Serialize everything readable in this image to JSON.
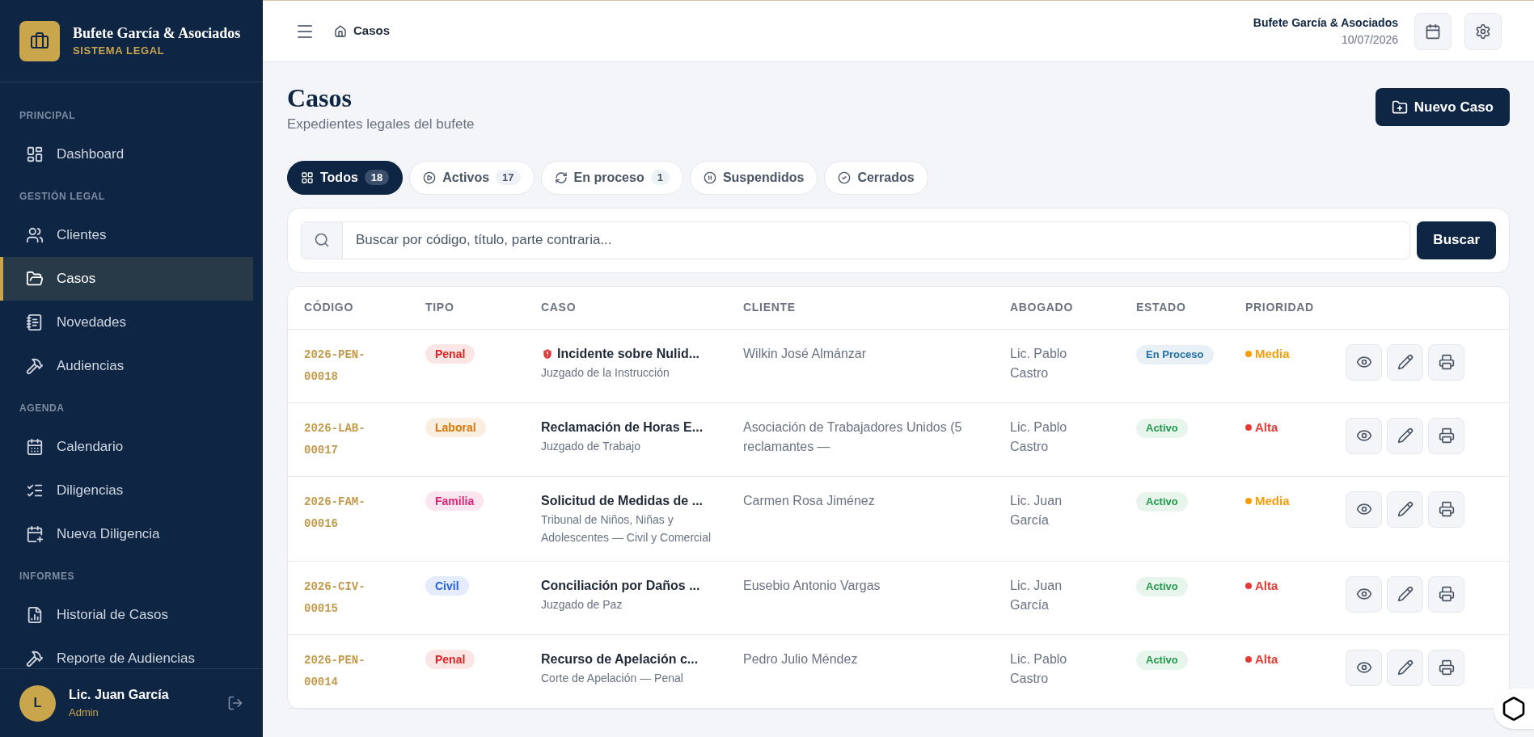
{
  "brand": {
    "name": "Bufete García & Asociados",
    "subtitle": "SISTEMA LEGAL"
  },
  "sidebar": {
    "sections": [
      {
        "title": "PRINCIPAL",
        "items": [
          {
            "label": "Dashboard",
            "selected": false
          }
        ]
      },
      {
        "title": "GESTIÓN LEGAL",
        "items": [
          {
            "label": "Clientes",
            "selected": false
          },
          {
            "label": "Casos",
            "selected": true
          },
          {
            "label": "Novedades",
            "selected": false
          },
          {
            "label": "Audiencias",
            "selected": false
          }
        ]
      },
      {
        "title": "AGENDA",
        "items": [
          {
            "label": "Calendario",
            "selected": false
          },
          {
            "label": "Diligencias",
            "selected": false
          },
          {
            "label": "Nueva Diligencia",
            "selected": false
          }
        ]
      },
      {
        "title": "INFORMES",
        "items": [
          {
            "label": "Historial de Casos",
            "selected": false
          },
          {
            "label": "Reporte de Audiencias",
            "selected": false
          }
        ]
      }
    ],
    "user": {
      "initial": "L",
      "name": "Lic. Juan García",
      "role": "Admin"
    }
  },
  "header": {
    "breadcrumb": "Casos",
    "firm": "Bufete García & Asociados",
    "date": "10/07/2026"
  },
  "page": {
    "title": "Casos",
    "subtitle": "Expedientes legales del bufete",
    "new_button": "Nuevo Caso"
  },
  "tabs": [
    {
      "label": "Todos",
      "count": "18",
      "selected": true
    },
    {
      "label": "Activos",
      "count": "17",
      "selected": false
    },
    {
      "label": "En proceso",
      "count": "1",
      "selected": false
    },
    {
      "label": "Suspendidos",
      "selected": false
    },
    {
      "label": "Cerrados",
      "selected": false
    }
  ],
  "search": {
    "placeholder": "Buscar por código, título, parte contraria...",
    "button": "Buscar"
  },
  "table": {
    "columns": [
      "CÓDIGO",
      "TIPO",
      "CASO",
      "CLIENTE",
      "ABOGADO",
      "ESTADO",
      "PRIORIDAD"
    ],
    "rows": [
      {
        "code": "2026-PEN-00018",
        "type": {
          "label": "Penal",
          "color": "#dc2626"
        },
        "title": "Incidente sobre Nulid...",
        "confidential": true,
        "court": "Juzgado de la Instrucción",
        "client": "Wilkin José Almánzar",
        "lawyer": "Lic. Pablo Castro",
        "status": {
          "label": "En Proceso",
          "color": "#1f6fa8"
        },
        "priority": {
          "label": "Media",
          "color": "#f59e0b"
        }
      },
      {
        "code": "2026-LAB-00017",
        "type": {
          "label": "Laboral",
          "color": "#d97706"
        },
        "title": "Reclamación de Horas E...",
        "confidential": false,
        "court": "Juzgado de Trabajo",
        "client": "Asociación de Trabajadores Unidos (5 reclamantes —",
        "lawyer": "Lic. Pablo Castro",
        "status": {
          "label": "Activo",
          "color": "#21994a"
        },
        "priority": {
          "label": "Alta",
          "color": "#e53935"
        }
      },
      {
        "code": "2026-FAM-00016",
        "type": {
          "label": "Familia",
          "color": "#db2777"
        },
        "title": "Solicitud de Medidas de ...",
        "confidential": false,
        "court": "Tribunal de Niños, Niñas y Adolescentes — Civil y Comercial",
        "client": "Carmen Rosa Jiménez",
        "lawyer": "Lic. Juan García",
        "status": {
          "label": "Activo",
          "color": "#21994a"
        },
        "priority": {
          "label": "Media",
          "color": "#f59e0b"
        }
      },
      {
        "code": "2026-CIV-00015",
        "type": {
          "label": "Civil",
          "color": "#2563eb"
        },
        "title": "Conciliación por Daños ...",
        "confidential": false,
        "court": "Juzgado de Paz",
        "client": "Eusebio Antonio Vargas",
        "lawyer": "Lic. Juan García",
        "status": {
          "label": "Activo",
          "color": "#21994a"
        },
        "priority": {
          "label": "Alta",
          "color": "#e53935"
        }
      },
      {
        "code": "2026-PEN-00014",
        "type": {
          "label": "Penal",
          "color": "#dc2626"
        },
        "title": "Recurso de Apelación c...",
        "confidential": false,
        "court": "Corte de Apelación — Penal",
        "client": "Pedro Julio Méndez",
        "lawyer": "Lic. Pablo Castro",
        "status": {
          "label": "Activo",
          "color": "#21994a"
        },
        "priority": {
          "label": "Alta",
          "color": "#e53935"
        }
      }
    ]
  }
}
